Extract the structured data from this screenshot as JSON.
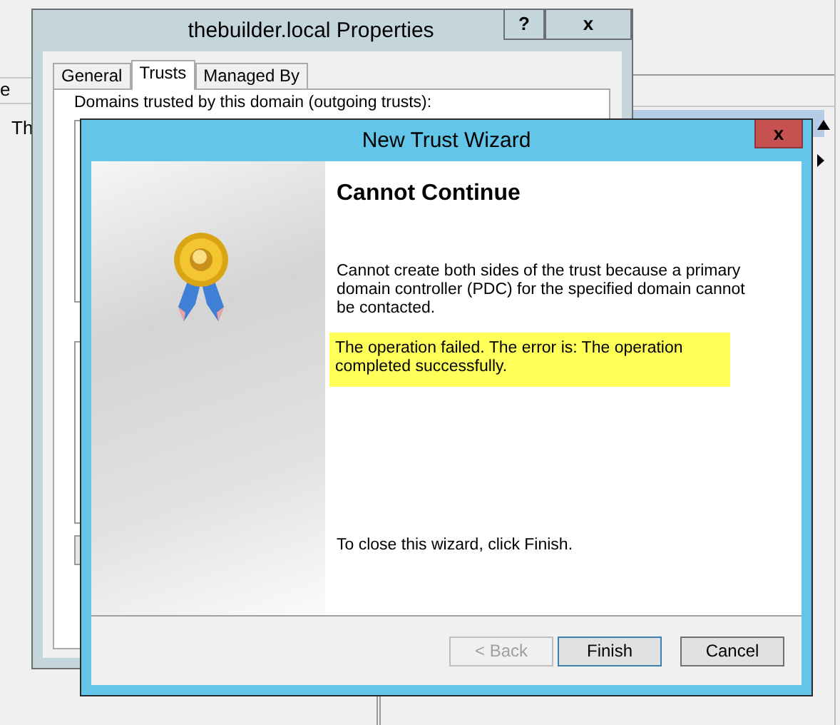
{
  "background_app": {
    "left_texts": [
      "e",
      "Th"
    ]
  },
  "properties_window": {
    "title": "thebuilder.local Properties",
    "title_buttons": [
      "?",
      "x"
    ],
    "tabs": [
      {
        "label": "General",
        "selected": false
      },
      {
        "label": "Trusts",
        "selected": true
      },
      {
        "label": "Managed By",
        "selected": false
      }
    ],
    "outgoing_label": "Domains trusted by this domain (outgoing trusts):"
  },
  "wizard": {
    "title": "New Trust Wizard",
    "close": "x",
    "heading": "Cannot Continue",
    "message": "Cannot create both sides of the trust because a primary domain controller (PDC) for the specified domain cannot be contacted.",
    "error_message": "The operation failed. The error is: The operation completed successfully.",
    "closing_note": "To close this wizard, click Finish.",
    "buttons": [
      {
        "label": "< Back",
        "disabled": true,
        "focused": false
      },
      {
        "label": "Finish",
        "disabled": false,
        "focused": true
      },
      {
        "label": "Cancel",
        "disabled": false,
        "focused": false
      }
    ]
  }
}
